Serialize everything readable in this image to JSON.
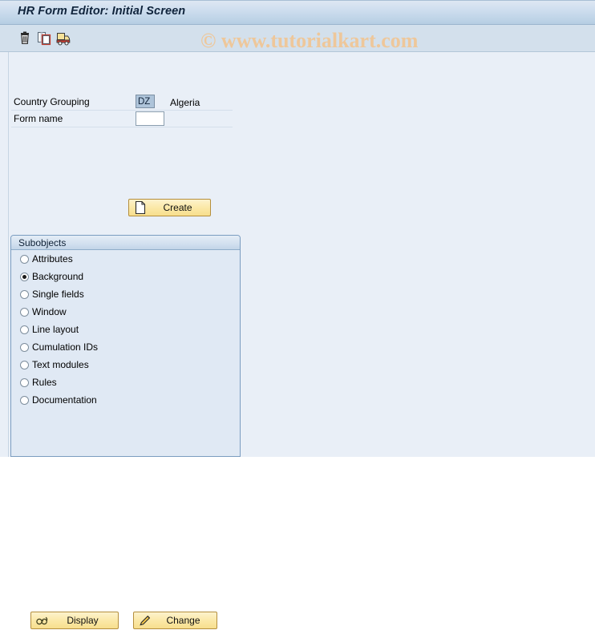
{
  "window": {
    "title": "HR Form Editor: Initial Screen"
  },
  "watermark": {
    "text": "© www.tutorialkart.com",
    "color": "#eec79a"
  },
  "toolbar": {
    "buttons": [
      {
        "name": "delete-icon",
        "tooltip": "Delete"
      },
      {
        "name": "copy-icon",
        "tooltip": "Copy"
      },
      {
        "name": "transport-icon",
        "tooltip": "Transport"
      }
    ]
  },
  "form": {
    "country_grouping": {
      "label": "Country Grouping",
      "value": "DZ",
      "description": "Algeria"
    },
    "form_name": {
      "label": "Form name",
      "value": "",
      "placeholder": ""
    },
    "create_button": {
      "label": "Create",
      "icon": "new-document-icon"
    }
  },
  "subobjects": {
    "title": "Subobjects",
    "selected": "Background",
    "options": [
      {
        "label": "Attributes",
        "checked": false
      },
      {
        "label": "Background",
        "checked": true
      },
      {
        "label": "Single fields",
        "checked": false
      },
      {
        "label": "Window",
        "checked": false
      },
      {
        "label": "Line layout",
        "checked": false
      },
      {
        "label": "Cumulation IDs",
        "checked": false
      },
      {
        "label": "Text modules",
        "checked": false
      },
      {
        "label": "Rules",
        "checked": false
      },
      {
        "label": "Documentation",
        "checked": false
      }
    ],
    "actions": {
      "display": {
        "label": "Display",
        "icon": "glasses-icon"
      },
      "change": {
        "label": "Change",
        "icon": "pencil-icon"
      }
    }
  },
  "colors": {
    "title_bar": "#b6cee3",
    "toolbar": "#d3e0ec",
    "content_bg": "#e9eff7",
    "button_gold": "#fbe9a8",
    "panel_border": "#7a9cc0",
    "input_selected": "#aec4da"
  }
}
